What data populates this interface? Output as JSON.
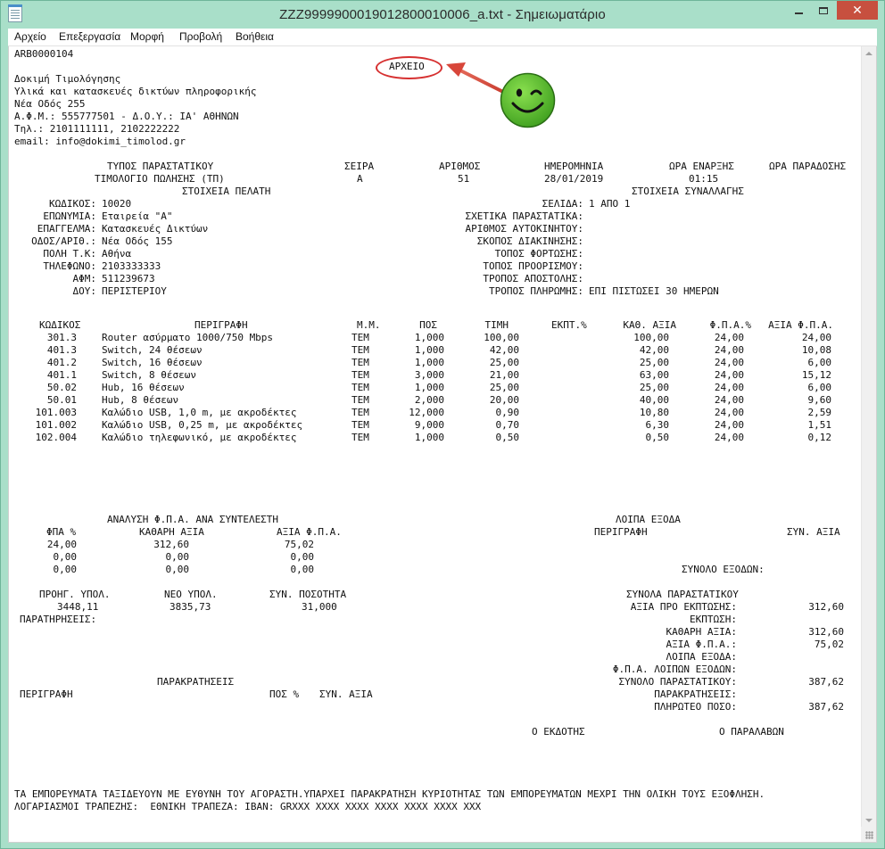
{
  "window": {
    "title": "ZZZ999990001901280001000​6_a.txt - Σημειωματάριο"
  },
  "menu": [
    "Αρχείο",
    "Επεξεργασία",
    "Μορφή",
    "Προβολή",
    "Βοήθεια"
  ],
  "doc": {
    "code": "ARB0000104",
    "stamp": "ΑΡΧΕΙΟ",
    "company": [
      "Δοκιμή Τιμολόγησης",
      "Υλικά και κατασκευές δικτύων πληροφορικής",
      "Νέα Οδός 255",
      "Α.Φ.Μ.: 555777501 - Δ.Ο.Υ.: ΙΑ' ΑΘΗΝΩΝ",
      "Τηλ.: 2101111111, 2102222222",
      "email: info@dokimi_timolod.gr"
    ],
    "head_labels": {
      "type": "ΤΥΠΟΣ ΠΑΡΑΣΤΑΤΙΚΟΥ",
      "series": "ΣΕΙΡΑ",
      "number": "ΑΡΙΘΜΟΣ",
      "date": "ΗΜΕΡΟΜΗΝΙΑ",
      "start": "ΩΡΑ ΕΝΑΡΞΗΣ",
      "delivery": "ΩΡΑ ΠΑΡΑΔΟΣΗΣ"
    },
    "head_values": {
      "type": "ΤΙΜΟΛΟΓΙΟ ΠΩΛΗΣΗΣ (ΤΠ)",
      "series": "Α",
      "number": "51",
      "date": "28/01/2019",
      "start": "01:15"
    },
    "customer_title": "ΣΤΟΙΧΕΙΑ ΠΕΛΑΤΗ",
    "transaction_title": "ΣΤΟΙΧΕΙΑ ΣΥΝΑΛΛΑΓΗΣ",
    "customer": [
      {
        "label": "ΚΩΔΙΚΟΣ:",
        "value": "10020"
      },
      {
        "label": "ΕΠΩΝΥΜΙΑ:",
        "value": "Εταιρεία \"Α\""
      },
      {
        "label": "ΕΠΑΓΓΕΛΜΑ:",
        "value": "Κατασκευές Δικτύων"
      },
      {
        "label": "ΟΔΟΣ/ΑΡΙΘ.:",
        "value": "Νέα Οδός 155"
      },
      {
        "label": "ΠΟΛΗ Τ.Κ:",
        "value": "Αθήνα"
      },
      {
        "label": "ΤΗΛΕΦΩΝΟ:",
        "value": "2103333333"
      },
      {
        "label": "ΑΦΜ:",
        "value": "511239673"
      },
      {
        "label": "ΔΟΥ:",
        "value": "ΠΕΡΙΣΤΕΡΙΟΥ"
      }
    ],
    "transaction": [
      {
        "label": "ΣΕΛΙΔΑ:",
        "value": "1 ΑΠΟ 1"
      },
      {
        "label": "ΣΧΕΤΙΚΑ ΠΑΡΑΣΤΑΤΙΚΑ:",
        "value": ""
      },
      {
        "label": "ΑΡΙΘΜΟΣ ΑΥΤΟΚΙΝΗΤΟΥ:",
        "value": ""
      },
      {
        "label": "ΣΚΟΠΟΣ ΔΙΑΚΙΝΗΣΗΣ:",
        "value": ""
      },
      {
        "label": "ΤΟΠΟΣ ΦΟΡΤΩΣΗΣ:",
        "value": ""
      },
      {
        "label": "ΤΟΠΟΣ ΠΡΟΟΡΙΣΜΟΥ:",
        "value": ""
      },
      {
        "label": "ΤΡΟΠΟΣ ΑΠΟΣΤΟΛΗΣ:",
        "value": ""
      },
      {
        "label": "ΤΡΟΠΟΣ ΠΛΗΡΩΜΗΣ:",
        "value": "ΕΠΙ ΠΙΣΤΩΣΕΙ 30 ΗΜΕΡΩΝ"
      }
    ],
    "items_header": {
      "code": "ΚΩΔΙΚΟΣ",
      "desc": "ΠΕΡΙΓΡΑΦΗ",
      "unit": "Μ.Μ.",
      "qty": "ΠΟΣ",
      "price": "ΤΙΜΗ",
      "disc": "ΕΚΠΤ.%",
      "net": "ΚΑΘ. ΑΞΙΑ",
      "vatp": "Φ.Π.Α.%",
      "vat": "ΑΞΙΑ Φ.Π.Α."
    },
    "items": [
      {
        "code": "301.3",
        "desc": "Router ασύρματο 1000/750 Mbps",
        "unit": "ΤΕΜ",
        "qty": "1,000",
        "price": "100,00",
        "net": "100,00",
        "vatp": "24,00",
        "vat": "24,00"
      },
      {
        "code": "401.3",
        "desc": "Switch, 24 θέσεων",
        "unit": "ΤΕΜ",
        "qty": "1,000",
        "price": "42,00",
        "net": "42,00",
        "vatp": "24,00",
        "vat": "10,08"
      },
      {
        "code": "401.2",
        "desc": "Switch, 16 θέσεων",
        "unit": "ΤΕΜ",
        "qty": "1,000",
        "price": "25,00",
        "net": "25,00",
        "vatp": "24,00",
        "vat": "6,00"
      },
      {
        "code": "401.1",
        "desc": "Switch, 8 θέσεων",
        "unit": "ΤΕΜ",
        "qty": "3,000",
        "price": "21,00",
        "net": "63,00",
        "vatp": "24,00",
        "vat": "15,12"
      },
      {
        "code": "50.02",
        "desc": "Hub, 16 θέσεων",
        "unit": "ΤΕΜ",
        "qty": "1,000",
        "price": "25,00",
        "net": "25,00",
        "vatp": "24,00",
        "vat": "6,00"
      },
      {
        "code": "50.01",
        "desc": "Hub, 8 θέσεων",
        "unit": "ΤΕΜ",
        "qty": "2,000",
        "price": "20,00",
        "net": "40,00",
        "vatp": "24,00",
        "vat": "9,60"
      },
      {
        "code": "101.003",
        "desc": "Καλώδιο USB, 1,0 m, με ακροδέκτες",
        "unit": "ΤΕΜ",
        "qty": "12,000",
        "price": "0,90",
        "net": "10,80",
        "vatp": "24,00",
        "vat": "2,59"
      },
      {
        "code": "101.002",
        "desc": "Καλώδιο USB, 0,25 m, με ακροδέκτες",
        "unit": "ΤΕΜ",
        "qty": "9,000",
        "price": "0,70",
        "net": "6,30",
        "vatp": "24,00",
        "vat": "1,51"
      },
      {
        "code": "102.004",
        "desc": "Καλώδιο τηλεφωνικό, με ακροδέκτες",
        "unit": "ΤΕΜ",
        "qty": "1,000",
        "price": "0,50",
        "net": "0,50",
        "vatp": "24,00",
        "vat": "0,12"
      }
    ],
    "vat_analysis": {
      "title": "ΑΝΑΛΥΣΗ Φ.Π.Α. ΑΝΑ ΣΥΝΤΕΛΕΣΤΗ",
      "headers": [
        "ΦΠΑ %",
        "ΚΑΘΑΡΗ ΑΞΙΑ",
        "ΑΞΙΑ Φ.Π.Α."
      ],
      "rows": [
        [
          "24,00",
          "312,60",
          "75,02"
        ],
        [
          "0,00",
          "0,00",
          "0,00"
        ],
        [
          "0,00",
          "0,00",
          "0,00"
        ]
      ]
    },
    "other_expenses": {
      "title": "ΛΟΙΠΑ ΕΞΟΔΑ",
      "desc": "ΠΕΡΙΓΡΑΦΗ",
      "value": "ΣΥΝ. ΑΞΙΑ",
      "total": "ΣΥΝΟΛΟ ΕΞΟΔΩΝ:"
    },
    "balance": {
      "headers": [
        "ΠΡΟΗΓ. ΥΠΟΛ.",
        "ΝΕΟ ΥΠΟΛ.",
        "ΣΥΝ. ΠΟΣΟΤΗΤΑ"
      ],
      "values": [
        "3448,11",
        "3835,73",
        "31,000"
      ]
    },
    "remarks": "ΠΑΡΑΤΗΡΗΣΕΙΣ:",
    "totals_title": "ΣΥΝΟΛΑ ΠΑΡΑΣΤΑΤΙΚΟΥ",
    "totals": [
      {
        "label": "ΑΞΙΑ ΠΡΟ ΕΚΠΤΩΣΗΣ:",
        "value": "312,60"
      },
      {
        "label": "ΕΚΠΤΩΣΗ:",
        "value": ""
      },
      {
        "label": "ΚΑΘΑΡΗ ΑΞΙΑ:",
        "value": "312,60"
      },
      {
        "label": "ΑΞΙΑ Φ.Π.Α.:",
        "value": "75,02"
      },
      {
        "label": "ΛΟΙΠΑ ΕΞΟΔΑ:",
        "value": ""
      },
      {
        "label": "Φ.Π.Α. ΛΟΙΠΩΝ ΕΞΟΔΩΝ:",
        "value": ""
      },
      {
        "label": "ΣΥΝΟΛΟ ΠΑΡΑΣΤΑΤΙΚΟΥ:",
        "value": "387,62"
      },
      {
        "label": "ΠΑΡΑΚΡΑΤΗΣΕΙΣ:",
        "value": ""
      },
      {
        "label": "ΠΛΗΡΩΤΕΟ ΠΟΣΟ:",
        "value": "387,62"
      }
    ],
    "withholdings": {
      "title": "ΠΑΡΑΚΡΑΤΗΣΕΙΣ",
      "headers": [
        "ΠΕΡΙΓΡΑΦΗ",
        "ΠΟΣ %",
        "ΣΥΝ. ΑΞΙΑ"
      ]
    },
    "issuer": "Ο ΕΚΔΟΤΗΣ",
    "receiver": "Ο ΠΑΡΑΛΑΒΩΝ",
    "footer": [
      "ΤΑ ΕΜΠΟΡΕΥΜΑΤΑ ΤΑΞΙΔΕΥΟΥΝ ΜΕ ΕΥΘΥΝΗ ΤΟΥ ΑΓΟΡΑΣΤΗ.ΥΠΑΡΧΕΙ ΠΑΡΑΚΡΑΤΗΣΗ ΚΥΡΙΟΤΗΤΑΣ ΤΩΝ ΕΜΠΟΡΕΥΜΑΤΩΝ ΜΕΧΡΙ ΤΗΝ ΟΛΙΚΗ ΤΟΥΣ ΕΞΟΦΛΗΣΗ.",
      "ΛΟΓΑΡΙΑΣΜΟΙ ΤΡΑΠΕΖΗΣ:  ΕΘΝΙΚΗ ΤΡΑΠΕΖΑ: IBAN: GRXXX XXXX XXXX XXXX XXXX XXXX XXX"
    ]
  },
  "colors": {
    "frame": "#a9dfc9",
    "close": "#c7503f",
    "stamp": "#d63030",
    "smiley": "#5fc12f"
  }
}
